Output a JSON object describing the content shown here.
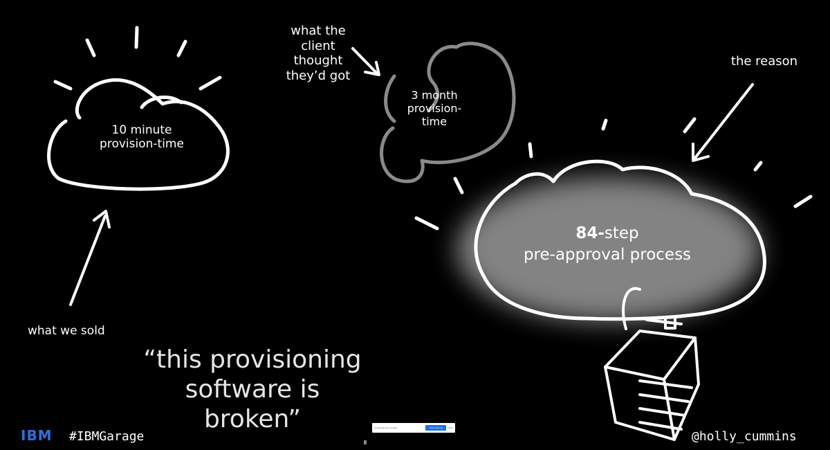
{
  "slide": {
    "left_cloud_label": [
      "10 minute",
      "provision-time"
    ],
    "left_arrow_label": "what we sold",
    "middle_cloud_label": [
      "3 month",
      "provision-",
      "time"
    ],
    "middle_annotation": [
      "what the",
      "client",
      "thought",
      "they’d got"
    ],
    "right_annotation": "the reason",
    "right_cloud_bold": "84-",
    "right_cloud_rest": "step",
    "right_cloud_line2": "pre-approval process",
    "quote": [
      "“this provisioning",
      "software is broken”"
    ]
  },
  "footer": {
    "logo": "IBM",
    "hashtag": "#IBMGarage",
    "handle": "@holly_cummins"
  },
  "colors": {
    "background": "#000000",
    "chalk": "#ffffff",
    "grey_cloud": "#8a8a8a",
    "ibm_blue": "#2f6fe0"
  },
  "overlay": {
    "share_text": "is sharing your screen",
    "stop_label": "Stop sharing",
    "hide_label": "Hide"
  }
}
